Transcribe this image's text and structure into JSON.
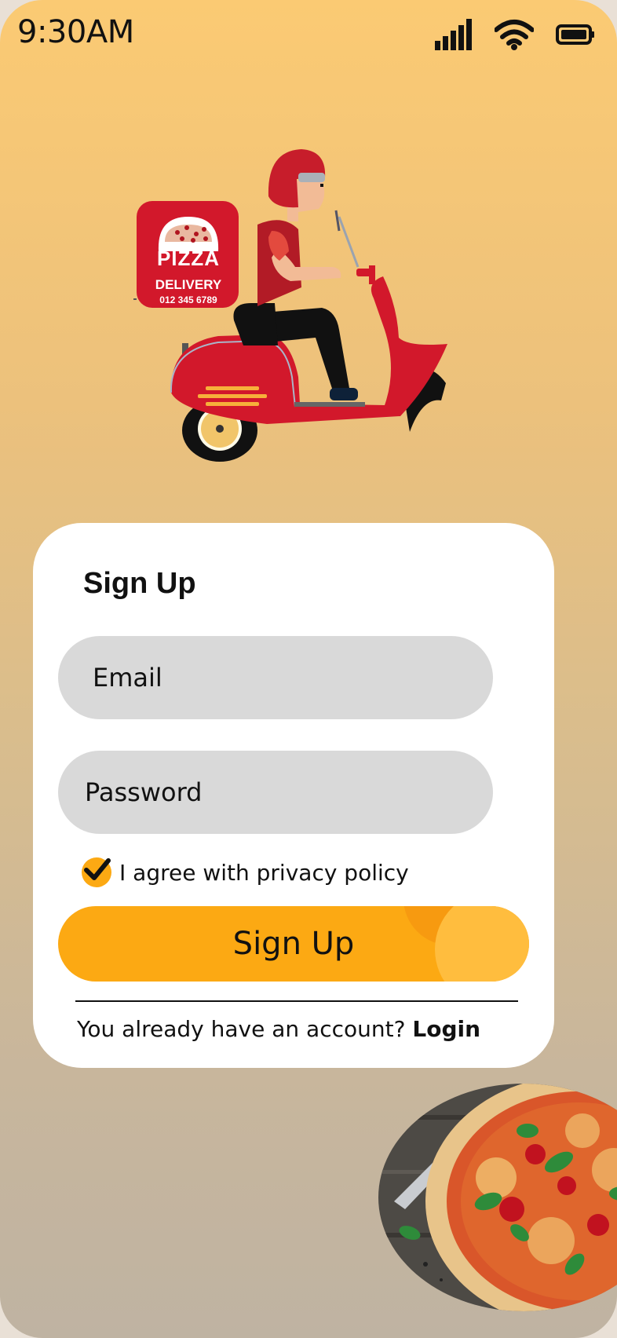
{
  "status_bar": {
    "time": "9:30AM",
    "icons": [
      "signal-icon",
      "wifi-icon",
      "battery-icon"
    ]
  },
  "illustration": {
    "box_brand": "PIZZA",
    "box_line1": "DELIVERY",
    "box_line2": "012 345 6789"
  },
  "signup_form": {
    "title": "Sign Up",
    "email_placeholder": "Email",
    "password_placeholder": "Password",
    "agree_label": "I agree with privacy policy",
    "agree_checked": true,
    "submit_label": "Sign Up",
    "login_prompt": "You already have an account?",
    "login_link": "Login"
  },
  "colors": {
    "accent": "#fca913",
    "field_bg": "#d9d9d9",
    "card_bg": "#ffffff",
    "background_top": "#fbca73",
    "background_bottom": "#bfb3a2",
    "scooter_red": "#d2182b"
  }
}
